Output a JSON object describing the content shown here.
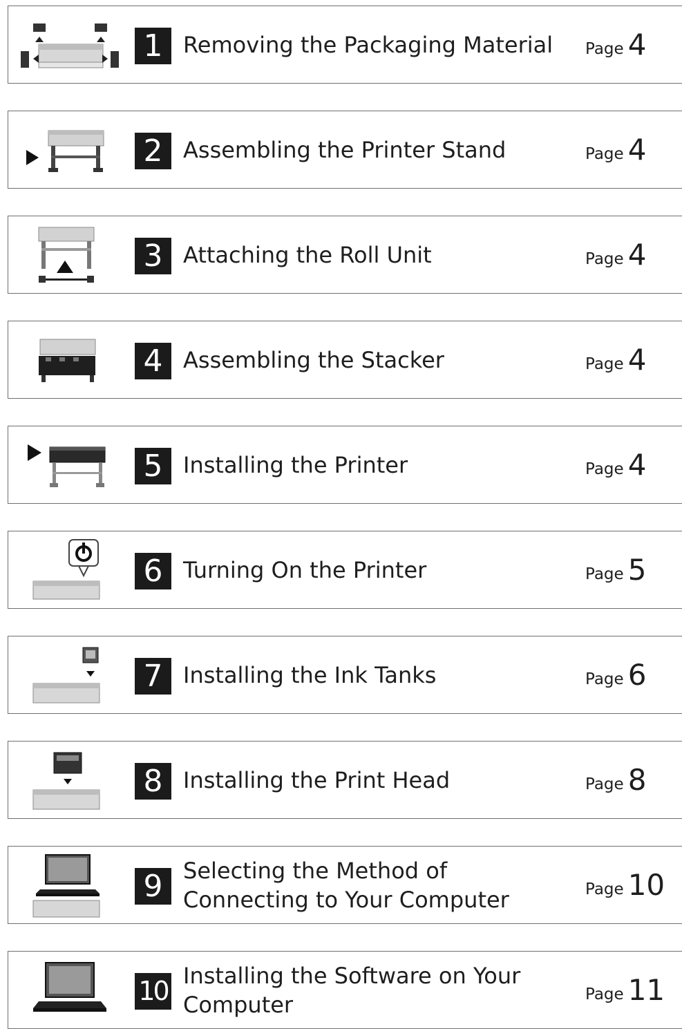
{
  "steps": [
    {
      "number": "1",
      "title": "Removing the Packaging Material",
      "page_label": "Page",
      "page": "4",
      "icon": "unpacking-icon"
    },
    {
      "number": "2",
      "title": "Assembling the Printer Stand",
      "page_label": "Page",
      "page": "4",
      "icon": "printer-stand-icon"
    },
    {
      "number": "3",
      "title": "Attaching the Roll Unit",
      "page_label": "Page",
      "page": "4",
      "icon": "roll-unit-icon"
    },
    {
      "number": "4",
      "title": "Assembling the Stacker",
      "page_label": "Page",
      "page": "4",
      "icon": "stacker-icon"
    },
    {
      "number": "5",
      "title": "Installing the Printer",
      "page_label": "Page",
      "page": "4",
      "icon": "printer-install-icon"
    },
    {
      "number": "6",
      "title": "Turning On the Printer",
      "page_label": "Page",
      "page": "5",
      "icon": "power-on-icon"
    },
    {
      "number": "7",
      "title": "Installing the Ink Tanks",
      "page_label": "Page",
      "page": "6",
      "icon": "ink-tank-icon"
    },
    {
      "number": "8",
      "title": "Installing the Print Head",
      "page_label": "Page",
      "page": "8",
      "icon": "print-head-icon"
    },
    {
      "number": "9",
      "title": "Selecting the Method of Connecting to Your Computer",
      "page_label": "Page",
      "page": "10",
      "icon": "connection-laptop-icon"
    },
    {
      "number": "10",
      "title": "Installing the Software on Your Computer",
      "page_label": "Page",
      "page": "11",
      "icon": "software-laptop-icon"
    }
  ]
}
